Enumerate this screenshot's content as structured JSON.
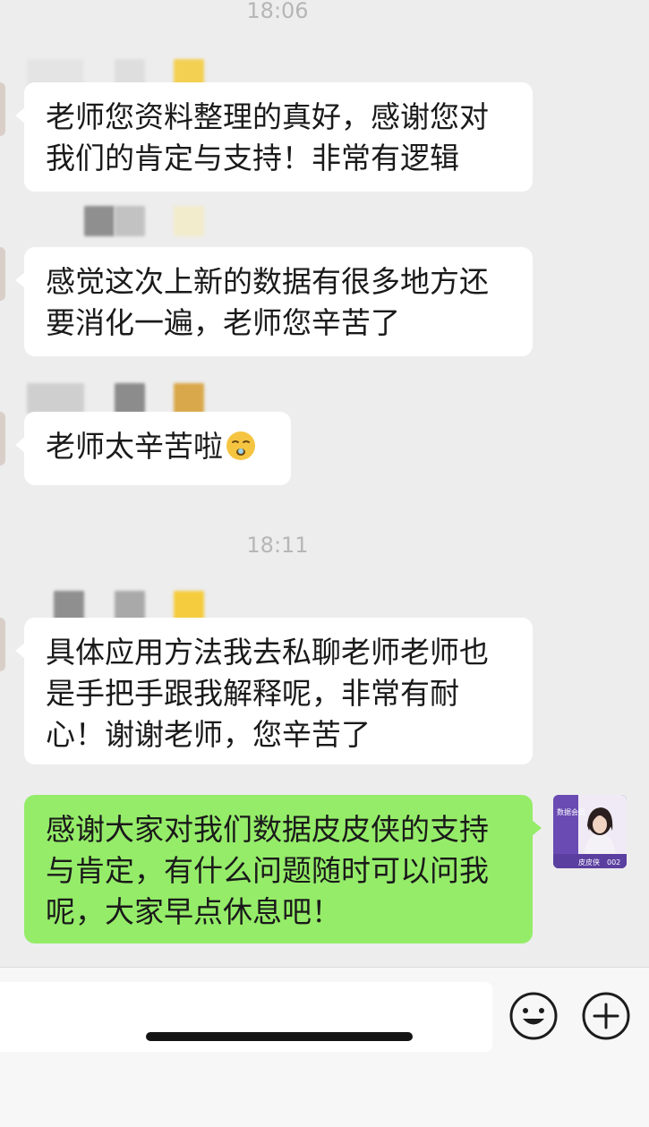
{
  "timestamps": [
    "18:06",
    "18:11"
  ],
  "messages": [
    {
      "side": "left",
      "text": "老师您资料整理的真好，感谢您对\n我们的肯定与支持！非常有逻辑"
    },
    {
      "side": "left",
      "text": "感觉这次上新的数据有很多地方还\n要消化一遍，老师您辛苦了"
    },
    {
      "side": "left",
      "text": "老师太辛苦啦",
      "emoji": "sleeping-face-emoji"
    },
    {
      "side": "left",
      "text": "具体应用方法我去私聊老师老师也\n是手把手跟我解释呢，非常有耐\n心！谢谢老师，您辛苦了"
    },
    {
      "side": "right",
      "text": "感谢大家对我们数据皮皮侠的支持\n与肯定，有什么问题随时可以问我\n呢，大家早点休息吧！"
    }
  ],
  "my_avatar": {
    "badge_text": "数据会员",
    "name_text": "皮皮侠",
    "number_text": "002"
  },
  "input_bar": {
    "value": "",
    "placeholder": "",
    "emoji_icon": "smiley-icon",
    "plus_icon": "plus-circle-icon"
  },
  "colors": {
    "background": "#ededed",
    "incoming_bubble": "#ffffff",
    "outgoing_bubble": "#95ec69",
    "timestamp_text": "#b6b6b6",
    "avatar_accent": "#6a4bb3"
  }
}
